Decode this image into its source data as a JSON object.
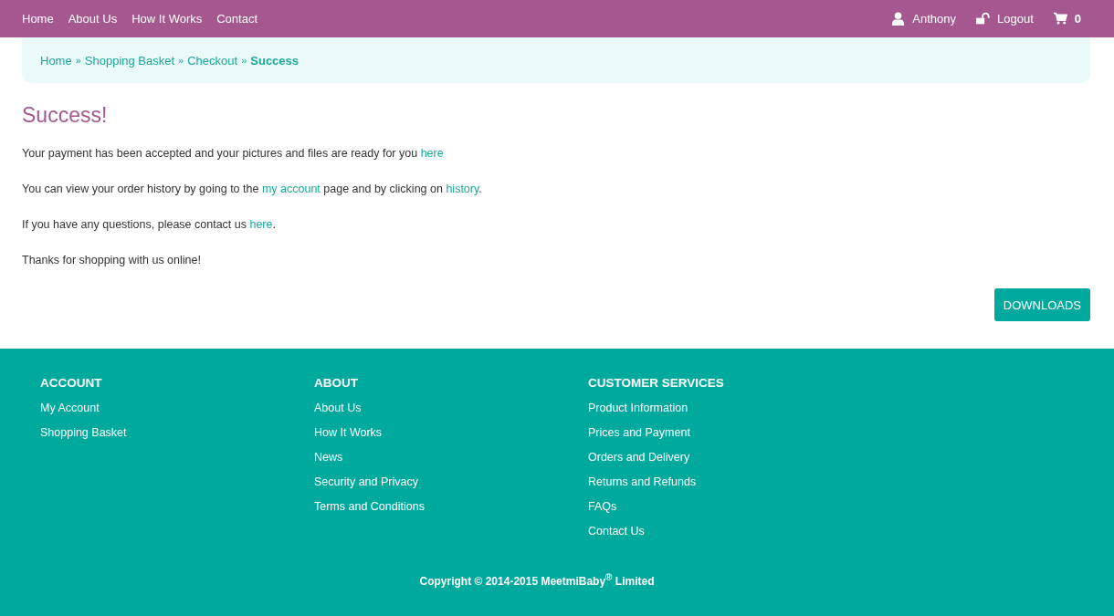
{
  "nav": {
    "links": [
      "Home",
      "About Us",
      "How It Works",
      "Contact"
    ],
    "user": "Anthony",
    "logout": "Logout",
    "cart_count": "0"
  },
  "breadcrumb": [
    {
      "kind": "link",
      "text": "Home"
    },
    {
      "kind": "separator",
      "text": "»"
    },
    {
      "kind": "link",
      "text": "Shopping Basket"
    },
    {
      "kind": "separator",
      "text": "»"
    },
    {
      "kind": "link",
      "text": "Checkout"
    },
    {
      "kind": "separator",
      "text": "»"
    },
    {
      "kind": "current",
      "text": "Success"
    }
  ],
  "heading": "Success!",
  "paragraphs": [
    [
      {
        "kind": "text",
        "text": "Your payment has been accepted and your pictures and files are ready for you "
      },
      {
        "kind": "link",
        "text": "here"
      }
    ],
    [
      {
        "kind": "text",
        "text": "You can view your order history by going to the "
      },
      {
        "kind": "link",
        "text": "my account"
      },
      {
        "kind": "text",
        "text": " page and by clicking on "
      },
      {
        "kind": "link",
        "text": "history"
      },
      {
        "kind": "text",
        "text": "."
      }
    ],
    [
      {
        "kind": "text",
        "text": "If you have any questions, please contact us "
      },
      {
        "kind": "link",
        "text": "here"
      },
      {
        "kind": "text",
        "text": "."
      }
    ],
    [
      {
        "kind": "text",
        "text": "Thanks for shopping with us online!"
      }
    ]
  ],
  "downloads_button": "DOWNLOADS",
  "footer": {
    "columns": [
      {
        "heading": "ACCOUNT",
        "links": [
          "My Account",
          "Shopping Basket"
        ]
      },
      {
        "heading": "ABOUT",
        "links": [
          "About Us",
          "How It Works",
          "News",
          "Security and Privacy",
          "Terms and Conditions"
        ]
      },
      {
        "heading": "CUSTOMER SERVICES",
        "links": [
          "Product Information",
          "Prices and Payment",
          "Orders and Delivery",
          "Returns and Refunds",
          "FAQs",
          "Contact Us"
        ]
      }
    ],
    "copyright": "Copyright © 2014-2015 MeetmiBaby$^{®}$ Limited"
  }
}
